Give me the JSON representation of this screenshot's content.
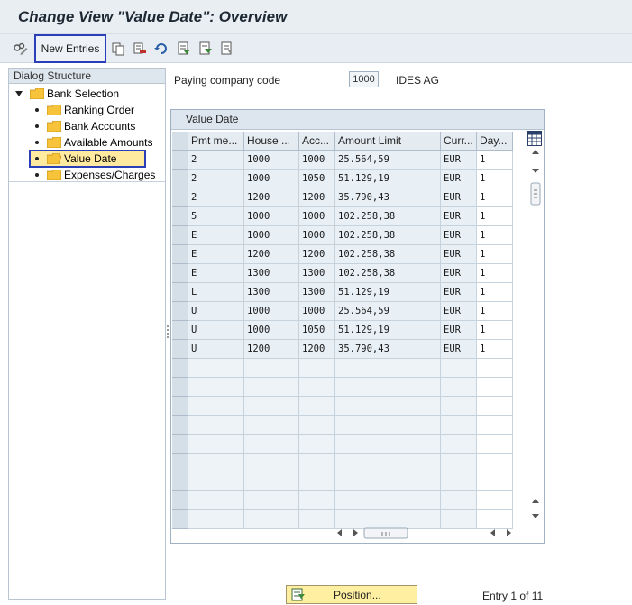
{
  "window": {
    "title": "Change View \"Value Date\": Overview"
  },
  "toolbar": {
    "new_entries_label": "New Entries"
  },
  "dialog_structure": {
    "header": "Dialog Structure",
    "root": {
      "label": "Bank Selection",
      "expanded": true
    },
    "items": [
      {
        "label": "Ranking Order",
        "selected": false
      },
      {
        "label": "Bank Accounts",
        "selected": false
      },
      {
        "label": "Available Amounts",
        "selected": false
      },
      {
        "label": "Value Date",
        "selected": true
      },
      {
        "label": "Expenses/Charges",
        "selected": false
      }
    ]
  },
  "company": {
    "label": "Paying company code",
    "code": "1000",
    "name": "IDES AG"
  },
  "table": {
    "title": "Value Date",
    "columns": [
      "Pmt me...",
      "House ...",
      "Acc...",
      "Amount Limit",
      "Curr...",
      "Day..."
    ],
    "rows": [
      [
        "2",
        "1000",
        "1000",
        "25.564,59",
        "EUR",
        "1"
      ],
      [
        "2",
        "1000",
        "1050",
        "51.129,19",
        "EUR",
        "1"
      ],
      [
        "2",
        "1200",
        "1200",
        "35.790,43",
        "EUR",
        "1"
      ],
      [
        "5",
        "1000",
        "1000",
        "102.258,38",
        "EUR",
        "1"
      ],
      [
        "E",
        "1000",
        "1000",
        "102.258,38",
        "EUR",
        "1"
      ],
      [
        "E",
        "1200",
        "1200",
        "102.258,38",
        "EUR",
        "1"
      ],
      [
        "E",
        "1300",
        "1300",
        "102.258,38",
        "EUR",
        "1"
      ],
      [
        "L",
        "1300",
        "1300",
        "51.129,19",
        "EUR",
        "1"
      ],
      [
        "U",
        "1000",
        "1000",
        "25.564,59",
        "EUR",
        "1"
      ],
      [
        "U",
        "1000",
        "1050",
        "51.129,19",
        "EUR",
        "1"
      ],
      [
        "U",
        "1200",
        "1200",
        "35.790,43",
        "EUR",
        "1"
      ]
    ]
  },
  "status": {
    "position_label": "Position...",
    "entry_info": "Entry 1 of 11"
  },
  "colors": {
    "accent": "#2b3fb8",
    "selection": "#ffeaa0",
    "title": "#1d2833"
  }
}
